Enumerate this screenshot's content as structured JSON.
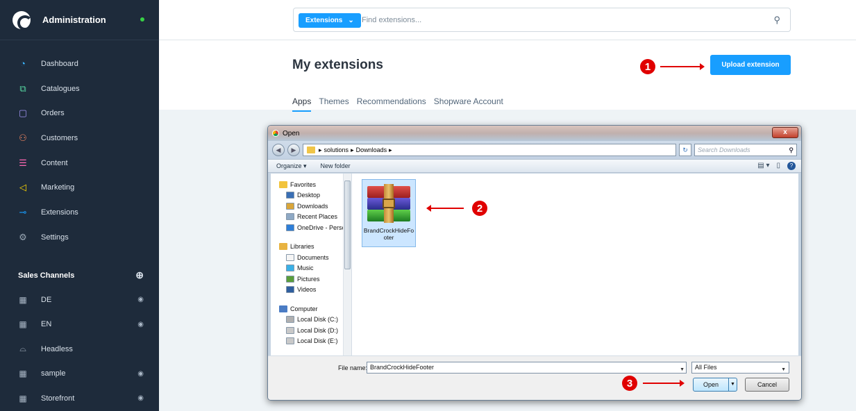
{
  "sidebar": {
    "title": "Administration",
    "nav": [
      {
        "label": "Dashboard",
        "icon": "dashboard-icon",
        "color": "#3bb5ff"
      },
      {
        "label": "Catalogues",
        "icon": "catalogue-icon",
        "color": "#57d9a3"
      },
      {
        "label": "Orders",
        "icon": "orders-icon",
        "color": "#a092f0"
      },
      {
        "label": "Customers",
        "icon": "customers-icon",
        "color": "#f88962"
      },
      {
        "label": "Content",
        "icon": "content-icon",
        "color": "#ff68b4"
      },
      {
        "label": "Marketing",
        "icon": "marketing-icon",
        "color": "#ffd700"
      },
      {
        "label": "Extensions",
        "icon": "extensions-icon",
        "color": "#189eff"
      },
      {
        "label": "Settings",
        "icon": "settings-icon",
        "color": "#9aa8b5"
      }
    ],
    "sales_channels_label": "Sales Channels",
    "channels": [
      {
        "label": "DE",
        "eye": true
      },
      {
        "label": "EN",
        "eye": true
      },
      {
        "label": "Headless",
        "eye": false
      },
      {
        "label": "sample",
        "eye": true
      },
      {
        "label": "Storefront",
        "eye": true
      }
    ]
  },
  "search": {
    "type_button": "Extensions",
    "placeholder": "Find extensions..."
  },
  "page": {
    "title": "My extensions",
    "upload_button": "Upload extension",
    "tabs": [
      "Apps",
      "Themes",
      "Recommendations",
      "Shopware Account"
    ]
  },
  "annotations": [
    "1",
    "2",
    "3"
  ],
  "dialog": {
    "title": "Open",
    "close": "x",
    "path": [
      "solutions",
      "Downloads"
    ],
    "search_placeholder": "Search Downloads",
    "organize": "Organize ▾",
    "new_folder": "New folder",
    "nav_groups": [
      {
        "label": "Favorites",
        "items": [
          "Desktop",
          "Downloads",
          "Recent Places",
          "OneDrive - Perso"
        ]
      },
      {
        "label": "Libraries",
        "items": [
          "Documents",
          "Music",
          "Pictures",
          "Videos"
        ]
      },
      {
        "label": "Computer",
        "items": [
          "Local Disk (C:)",
          "Local Disk (D:)",
          "Local Disk (E:)"
        ]
      }
    ],
    "file_name": "BrandCrockHideFooter",
    "file_label": "BrandCrockHideFooter",
    "file_name_label": "File name:",
    "file_type": "All Files",
    "open_button": "Open",
    "cancel_button": "Cancel"
  }
}
